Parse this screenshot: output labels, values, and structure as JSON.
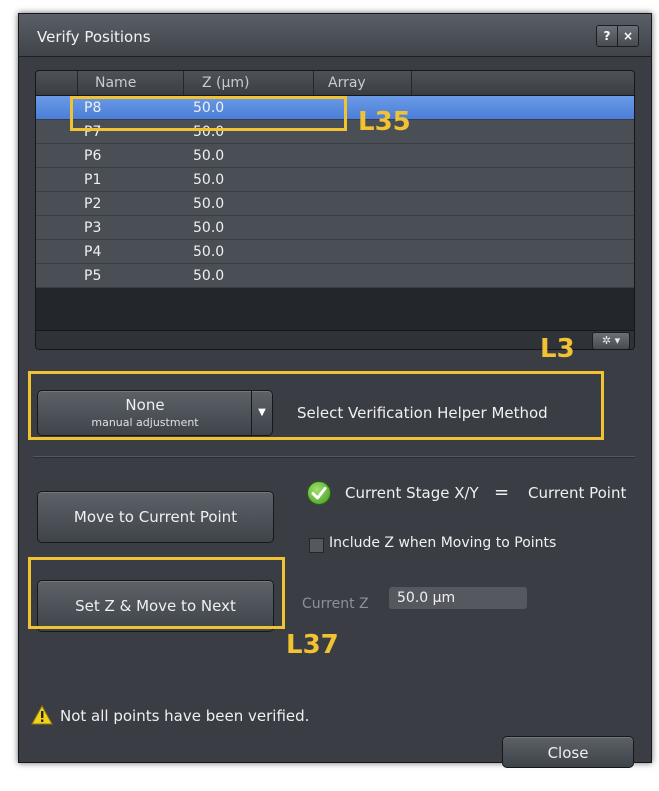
{
  "dialog": {
    "title": "Verify Positions",
    "help_label": "?",
    "close_label": "×"
  },
  "grid": {
    "columns": [
      "Name",
      "Z (µm)",
      "Array"
    ],
    "rows": [
      {
        "name": "P8",
        "z": "50.0",
        "array": "",
        "selected": true
      },
      {
        "name": "P7",
        "z": "50.0",
        "array": ""
      },
      {
        "name": "P6",
        "z": "50.0",
        "array": ""
      },
      {
        "name": "P1",
        "z": "50.0",
        "array": ""
      },
      {
        "name": "P2",
        "z": "50.0",
        "array": ""
      },
      {
        "name": "P3",
        "z": "50.0",
        "array": ""
      },
      {
        "name": "P4",
        "z": "50.0",
        "array": ""
      },
      {
        "name": "P5",
        "z": "50.0",
        "array": ""
      }
    ],
    "options_icon": "gear-icon"
  },
  "annotations": {
    "l35": "L35",
    "l3": "L3",
    "l37": "L37",
    "color": "#f1c232"
  },
  "helper": {
    "dropdown_value": "None",
    "dropdown_sub": "manual adjustment",
    "label": "Select Verification Helper Method"
  },
  "controls": {
    "move_button": "Move to Current Point",
    "stage_status_left": "Current Stage X/Y",
    "stage_status_eq": "=",
    "stage_status_right": "Current Point",
    "include_z_label": "Include Z when Moving to Points",
    "include_z_checked": false,
    "set_z_button": "Set Z & Move to Next",
    "current_z_label": "Current Z",
    "current_z_value": "50.0 µm"
  },
  "footer": {
    "warning": "Not all points have been verified.",
    "close_button": "Close"
  }
}
